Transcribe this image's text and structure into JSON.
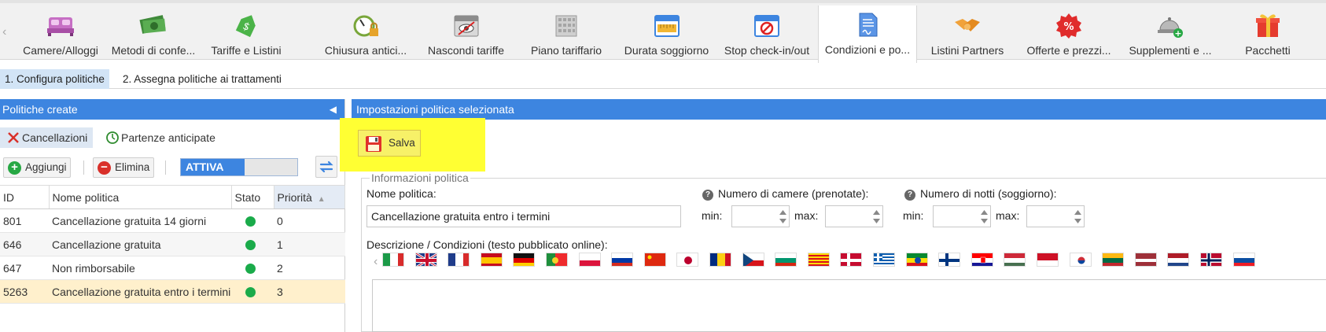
{
  "toolbar": {
    "tabs": [
      {
        "label": "Camere/Alloggi",
        "icon": "bed-icon"
      },
      {
        "label": "Metodi di confe...",
        "icon": "money-icon"
      },
      {
        "label": "Tariffe e Listini",
        "icon": "price-tag-icon"
      },
      {
        "label": "Chiusura antici...",
        "icon": "stopwatch-lock-icon"
      },
      {
        "label": "Nascondi tariffe",
        "icon": "calendar-hidden-icon"
      },
      {
        "label": "Piano tariffario",
        "icon": "grid-calendar-icon"
      },
      {
        "label": "Durata soggiorno",
        "icon": "calendar-ruler-icon"
      },
      {
        "label": "Stop check-in/out",
        "icon": "calendar-stop-icon"
      },
      {
        "label": "Condizioni e po...",
        "icon": "document-sign-icon",
        "active": true
      },
      {
        "label": "Listini Partners",
        "icon": "handshake-icon"
      },
      {
        "label": "Offerte e prezzi...",
        "icon": "percent-badge-icon"
      },
      {
        "label": "Supplementi e ...",
        "icon": "service-bell-plus-icon"
      },
      {
        "label": "Pacchetti",
        "icon": "gift-icon"
      }
    ]
  },
  "steps": {
    "step1": "1. Configura politiche",
    "step2": "2. Assegna politiche ai trattamenti"
  },
  "left_panel": {
    "title": "Politiche create",
    "subtabs": {
      "cancellations": "Cancellazioni",
      "early_departures": "Partenze anticipate"
    },
    "buttons": {
      "add": "Aggiungi",
      "delete": "Elimina"
    },
    "toggle": {
      "label": "ATTIVA",
      "fill_fraction": 0.55
    },
    "table": {
      "headers": {
        "id": "ID",
        "name": "Nome politica",
        "status": "Stato",
        "priority": "Priorità"
      },
      "rows": [
        {
          "id": "801",
          "name": "Cancellazione gratuita 14 giorni",
          "status": "active",
          "priority": "0"
        },
        {
          "id": "646",
          "name": "Cancellazione gratuita",
          "status": "active",
          "priority": "1"
        },
        {
          "id": "647",
          "name": "Non rimborsabile",
          "status": "active",
          "priority": "2"
        },
        {
          "id": "5263",
          "name": "Cancellazione gratuita entro i termini",
          "status": "active",
          "priority": "3"
        }
      ]
    }
  },
  "right_panel": {
    "title": "Impostazioni politica selezionata",
    "save_label": "Salva",
    "legend": "Informazioni politica",
    "policy_name_label": "Nome politica:",
    "policy_name_value": "Cancellazione gratuita entro i termini",
    "rooms_label": "Numero di camere (prenotate):",
    "nights_label": "Numero di notti (soggiorno):",
    "min_label": "min:",
    "max_label": "max:",
    "description_label": "Descrizione / Condizioni (testo pubblicato online):",
    "flags": [
      "italy",
      "united-kingdom",
      "france",
      "spain",
      "germany",
      "portugal",
      "poland",
      "russia",
      "china",
      "japan",
      "romania",
      "czech-republic",
      "bulgaria",
      "catalonia",
      "denmark",
      "greece",
      "ethiopia",
      "finland",
      "croatia",
      "hungary",
      "indonesia",
      "south-korea",
      "lithuania",
      "latvia",
      "netherlands",
      "norway",
      "slovakia"
    ]
  },
  "colors": {
    "accent_blue": "#3d85e0",
    "highlight_yellow": "#ffff33",
    "selected_row": "#fff0cc",
    "status_green": "#1aab4a"
  }
}
